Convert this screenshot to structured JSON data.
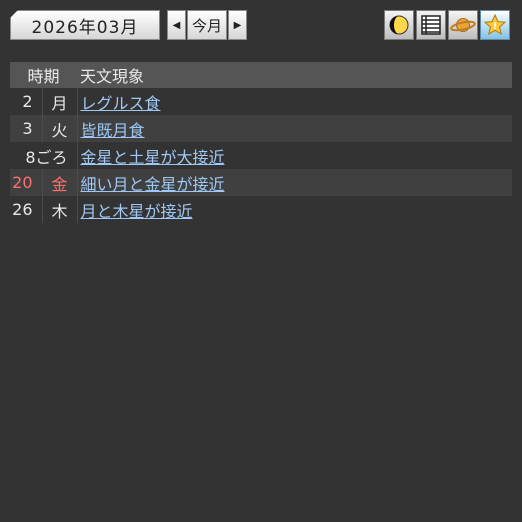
{
  "header": {
    "month_title": "2026年03月",
    "prev_label": "◀",
    "today_label": "今月",
    "next_label": "▶"
  },
  "toolbar_icons": [
    "moon-phase-icon",
    "list-icon",
    "planet-icon",
    "star-icon"
  ],
  "table": {
    "col_time": "時期",
    "col_event": "天文現象",
    "rows": [
      {
        "day": "2",
        "weekday": "月",
        "event": "レグルス食",
        "holiday": false
      },
      {
        "day": "3",
        "weekday": "火",
        "event": "皆既月食",
        "holiday": false
      },
      {
        "day": "8ごろ",
        "weekday": "",
        "event": "金星と土星が大接近",
        "holiday": false
      },
      {
        "day": "20",
        "weekday": "金",
        "event": "細い月と金星が接近",
        "holiday": true
      },
      {
        "day": "26",
        "weekday": "木",
        "event": "月と木星が接近",
        "holiday": false
      }
    ]
  },
  "colors": {
    "background": "#333333",
    "header_row": "#555555",
    "link": "#9fc8f5",
    "holiday": "#ff6f6f"
  }
}
